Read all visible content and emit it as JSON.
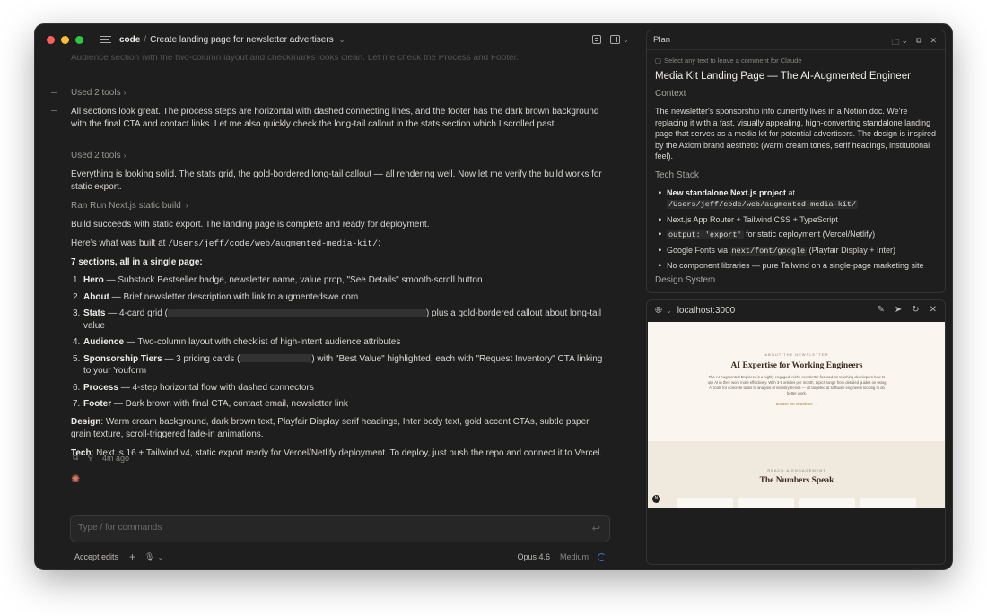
{
  "titlebar": {
    "project": "code",
    "separator": "/",
    "session": "Create landing page for newsletter advertisers"
  },
  "chat": {
    "faded_line": "Audience section with the two-column layout and checkmarks looks clean. Let me check the Process and Footer.",
    "tools_1": "Used 2 tools",
    "msg_1": "All sections look great. The process steps are horizontal with dashed connecting lines, and the footer has the dark brown background with the final CTA and contact links. Let me also quickly check the long-tail callout in the stats section which I scrolled past.",
    "tools_2": "Used 2 tools",
    "msg_2": "Everything is looking solid. The stats grid, the gold-bordered long-tail callout — all rendering well. Now let me verify the build works for static export.",
    "ran_prefix": "Ran",
    "ran_label": "Run Next.js static build",
    "msg_3": "Build succeeds with static export. The landing page is complete and ready for deployment.",
    "built_prefix": "Here’s what was built at",
    "built_path": "/Users/jeff/code/web/augmented-media-kit/",
    "built_suffix": ":",
    "sections_heading": "7 sections, all in a single page:",
    "sections": [
      {
        "num": "1.",
        "title": "Hero",
        "text": " — Substack Bestseller badge, newsletter name, value prop, \"See Details\" smooth-scroll button"
      },
      {
        "num": "2.",
        "title": "About",
        "text": " — Brief newsletter description with link to augmentedswe.com"
      },
      {
        "num": "3.",
        "title": "Stats",
        "text": " — 4-card grid (",
        "text_b": ") plus a gold-bordered callout about long-tail value"
      },
      {
        "num": "4.",
        "title": "Audience",
        "text": " — Two-column layout with checklist of high-intent audience attributes"
      },
      {
        "num": "5.",
        "title": "Sponsorship Tiers",
        "text": " — 3 pricing cards (",
        "text_b": ") with \"Best Value\" highlighted, each with \"Request Inventory\" CTA linking to your Youform"
      },
      {
        "num": "6.",
        "title": "Process",
        "text": " — 4-step horizontal flow with dashed connectors"
      },
      {
        "num": "7.",
        "title": "Footer",
        "text": " — Dark brown with final CTA, contact email, newsletter link"
      }
    ],
    "design_label": "Design",
    "design_text": ": Warm cream background, dark brown text, Playfair Display serif headings, Inter body text, gold accent CTAs, subtle paper grain texture, scroll-triggered fade-in animations.",
    "tech_label": "Tech",
    "tech_text": ": Next.js 16 + Tailwind v4, static export ready for Vercel/Netlify deployment. To deploy, just push the repo and connect it to Vercel.",
    "timestamp": "4m ago"
  },
  "composer": {
    "placeholder": "Type / for commands",
    "accept_edits": "Accept edits",
    "model": "Opus 4.6",
    "separator": "·",
    "effort": "Medium"
  },
  "plan": {
    "header": "Plan",
    "hint": "Select any text to leave a comment for Claude",
    "title": "Media Kit Landing Page — The AI-Augmented Engineer",
    "context_heading": "Context",
    "context_text": "The newsletter's sponsorship info currently lives in a Notion doc. We're replacing it with a fast, visually appealing, high-converting standalone landing page that serves as a media kit for potential advertisers. The design is inspired by the Axiom brand aesthetic (warm cream tones, serif headings, institutional feel).",
    "stack_heading": "Tech Stack",
    "stack": [
      {
        "bold": "New standalone Next.js project",
        "text": " at",
        "code": "/Users/jeff/code/web/augmented-media-kit/"
      },
      {
        "text": "Next.js App Router + Tailwind CSS + TypeScript"
      },
      {
        "code": "output: 'export'",
        "text": " for static deployment (Vercel/Netlify)"
      },
      {
        "text_a": "Google Fonts via ",
        "code": "next/font/google",
        "text": " (Playfair Display + Inter)"
      },
      {
        "text": "No component libraries — pure Tailwind on a single-page marketing site"
      }
    ],
    "next_heading": "Design System"
  },
  "preview": {
    "url": "localhost:3000",
    "about_kicker": "ABOUT THE NEWSLETTER",
    "about_title": "AI Expertise for Working Engineers",
    "about_body": "The AI-Augmented Engineer is a highly-engaged, niche newsletter focused on teaching developers how to use AI in their work more effectively. With 3-5 articles per month, topics range from detailed guides on using AI tools for concrete tasks to analysis of industry trends — all targeted at software engineers looking to do better work.",
    "about_link": "Browse the newsletter →",
    "stats_kicker": "REACH & ENGAGEMENT",
    "stats_title": "The Numbers Speak",
    "badge": "N"
  },
  "colors": {
    "window_bg": "#1e1e1e",
    "accent_orange": "#e07a5f",
    "cream": "#faf6ef",
    "dark_brown": "#3b2a1e",
    "gold": "#b07a2a"
  },
  "icons": {
    "sidebar": "sidebar-toggle-icon",
    "doc": "document-icon",
    "panel": "panel-layout-icon",
    "folder": "folder-icon",
    "copy": "copy-icon",
    "close": "close-icon",
    "globe": "globe-icon",
    "pencil": "pencil-icon",
    "pointer": "pointer-icon",
    "refresh": "refresh-icon"
  }
}
